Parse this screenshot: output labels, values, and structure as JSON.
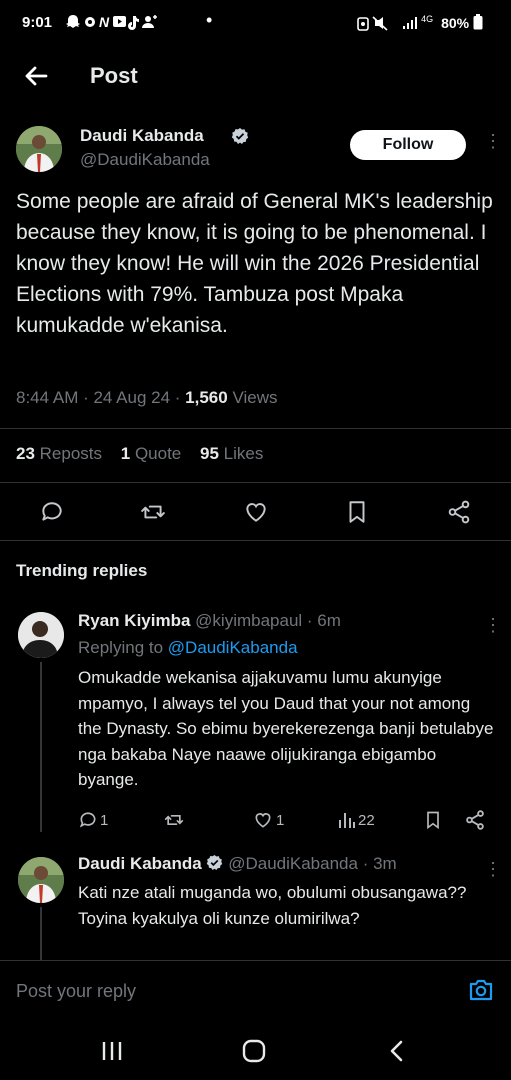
{
  "status_bar": {
    "time": "9:01",
    "left_icons": "snapchat-icon, settings-icon, n-icon, youtube-icon, tiktok-icon, add-user-icon, dot",
    "network": "4G",
    "battery": "80%"
  },
  "header": {
    "title": "Post"
  },
  "tweet": {
    "author_name": "Daudi Kabanda",
    "author_handle": "@DaudiKabanda",
    "follow_label": "Follow",
    "text": "Some people are afraid of General MK's leadership because they know, it is going to be phenomenal. I know they know! He will win the 2026 Presidential Elections with 79%. Tambuza post Mpaka kumukadde w'ekanisa.",
    "time_date": "8:44 AM · 24 Aug 24 · ",
    "views_count": "1,560",
    "views_label": " Views",
    "reposts_count": "23",
    "reposts_label": " Reposts",
    "quotes_count": "1",
    "quotes_label": " Quote",
    "likes_count": "95",
    "likes_label": " Likes"
  },
  "replies_section": {
    "title": "Trending replies"
  },
  "replies": [
    {
      "author_name": "Ryan Kiyimba",
      "author_handle": "@kiyimbapaul",
      "time": " · 6m",
      "replying_prefix": "Replying to ",
      "replying_to": "@DaudiKabanda",
      "text": "Omukadde wekanisa ajjakuvamu lumu akunyige mpamyo, I always tel you Daud that your not among the Dynasty. So ebimu byerekerezenga banji betulabye nga bakaba Naye naawe olijukiranga ebigambo byange.",
      "reply_count": "1",
      "like_count": "1",
      "views_count": "22"
    },
    {
      "author_name": "Daudi Kabanda",
      "author_handle": "@DaudiKabanda",
      "time": " · 3m",
      "text": "Kati nze atali muganda wo, obulumi obusangawa?? Toyina kyakulya oli kunze olumirilwa?"
    }
  ],
  "composer": {
    "placeholder": "Post your reply"
  },
  "colors": {
    "accent": "#1d9bf0",
    "verified": "#c9d1d9",
    "background": "#000000"
  }
}
